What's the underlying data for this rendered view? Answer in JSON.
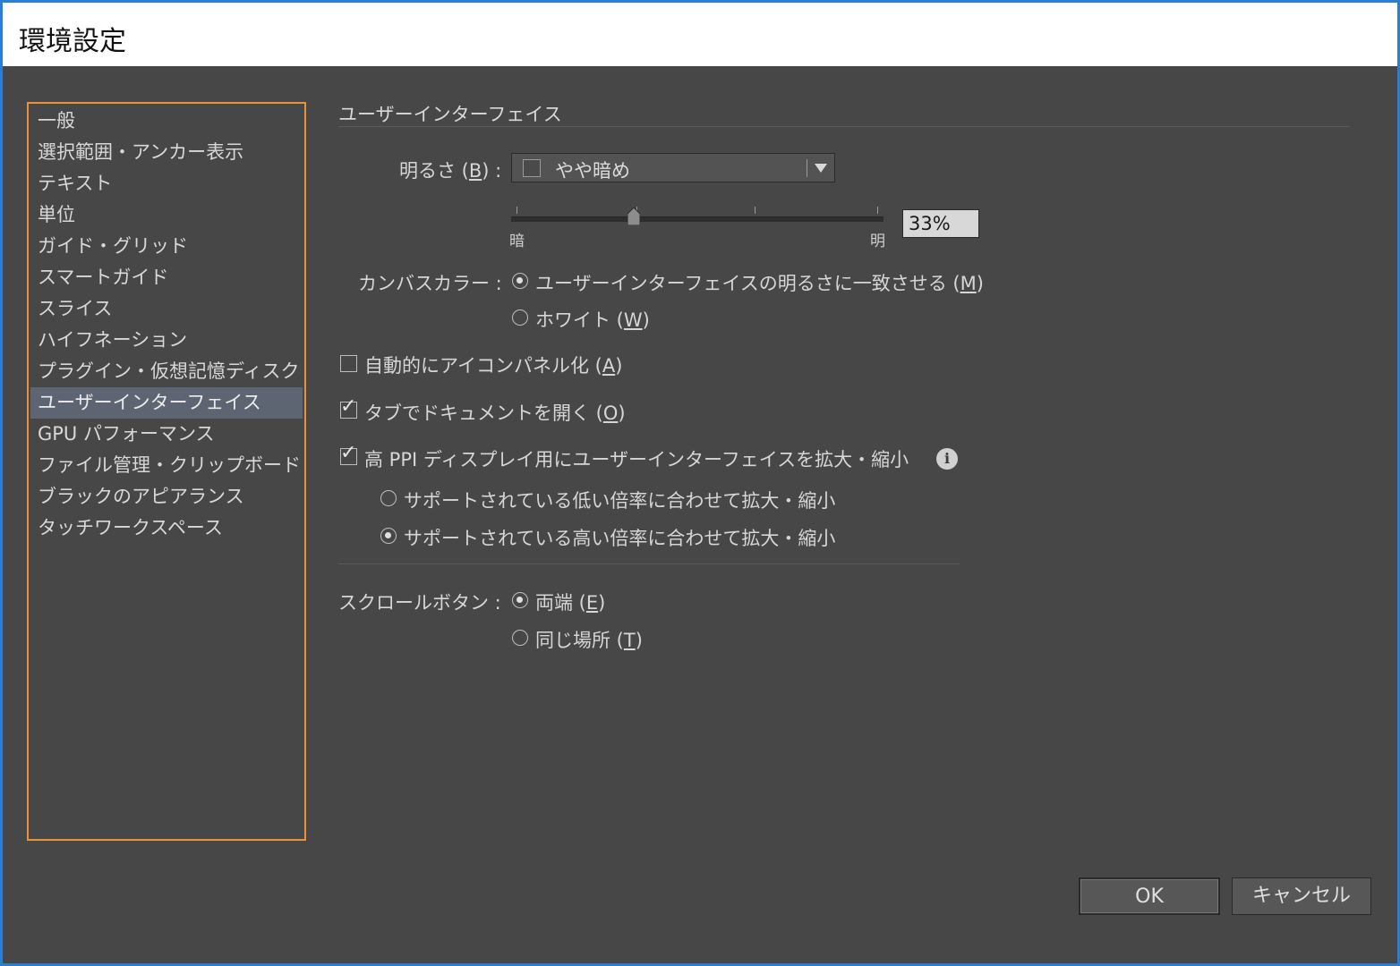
{
  "window": {
    "title": "環境設定"
  },
  "sidebar": {
    "items": [
      {
        "label": "一般"
      },
      {
        "label": "選択範囲・アンカー表示"
      },
      {
        "label": "テキスト"
      },
      {
        "label": "単位"
      },
      {
        "label": "ガイド・グリッド"
      },
      {
        "label": "スマートガイド"
      },
      {
        "label": "スライス"
      },
      {
        "label": "ハイフネーション"
      },
      {
        "label": "プラグイン・仮想記憶ディスク"
      },
      {
        "label": "ユーザーインターフェイス",
        "selected": true
      },
      {
        "label": "GPU パフォーマンス"
      },
      {
        "label": "ファイル管理・クリップボード"
      },
      {
        "label": "ブラックのアピアランス"
      },
      {
        "label": "タッチワークスペース"
      }
    ]
  },
  "main": {
    "section_title": "ユーザーインターフェイス",
    "brightness": {
      "label_prefix": "明るさ (",
      "label_key": "B",
      "label_suffix": ") :",
      "selected_value": "やや暗め",
      "slider_min_label": "暗",
      "slider_max_label": "明",
      "slider_value": 0.33,
      "percent_value": "33%"
    },
    "canvas_color": {
      "label": "カンバスカラー :",
      "options": [
        {
          "text": "ユーザーインターフェイスの明るさに一致させる (",
          "key": "M",
          "suffix": ")",
          "selected": true
        },
        {
          "text": "ホワイト (",
          "key": "W",
          "suffix": ")",
          "selected": false
        }
      ]
    },
    "auto_collapse": {
      "text": "自動的にアイコンパネル化 (",
      "key": "A",
      "suffix": ")",
      "checked": false
    },
    "open_in_tabs": {
      "text": "タブでドキュメントを開く (",
      "key": "O",
      "suffix": ")",
      "checked": true
    },
    "high_ppi": {
      "text": "高 PPI ディスプレイ用にユーザーインターフェイスを拡大・縮小",
      "checked": true,
      "options": [
        {
          "text": "サポートされている低い倍率に合わせて拡大・縮小",
          "selected": false
        },
        {
          "text": "サポートされている高い倍率に合わせて拡大・縮小",
          "selected": true
        }
      ]
    },
    "scroll_buttons": {
      "label": "スクロールボタン :",
      "options": [
        {
          "text": "両端 (",
          "key": "E",
          "suffix": ")",
          "selected": true
        },
        {
          "text": "同じ場所 (",
          "key": "T",
          "suffix": ")",
          "selected": false
        }
      ]
    }
  },
  "buttons": {
    "ok": "OK",
    "cancel": "キャンセル"
  },
  "colors": {
    "accent_border": "#e8913a",
    "window_border": "#2b7fd1",
    "selection": "#5c6571"
  }
}
